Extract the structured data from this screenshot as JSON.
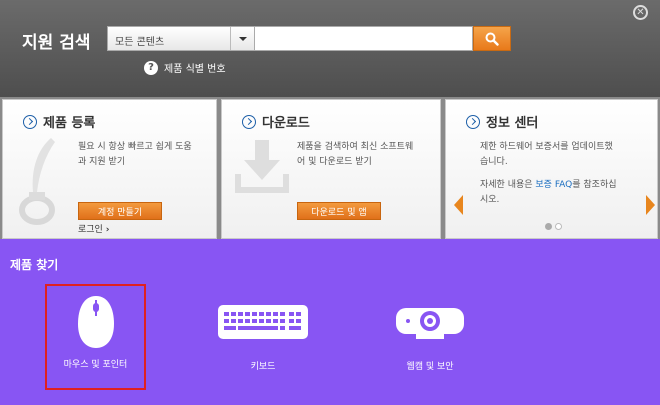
{
  "header": {
    "title": "지원 검색",
    "filter_value": "모든 콘텐츠",
    "search_value": "",
    "serial_link": "제품 식별 번호"
  },
  "cards": {
    "register": {
      "title": "제품 등록",
      "desc_line1": "필요 시 항상 빠르고 쉽게 도움",
      "desc_line2": "과 지원 받기",
      "button": "계정 만들기",
      "login": "로그인"
    },
    "download": {
      "title": "다운로드",
      "desc_line1": "제품을 검색하여 최신 소프트웨",
      "desc_line2": "어 및 다운로드 받기",
      "button": "다운로드 및 앱"
    },
    "info": {
      "title": "정보 센터",
      "desc_line1": "제한 하드웨어 보증서를 업데이트했",
      "desc_line2": "습니다.",
      "desc_line3_pre": "자세한 내용은 ",
      "desc_line3_link": "보증 FAQ",
      "desc_line3_post": "를 참조하십",
      "desc_line4": "시오."
    }
  },
  "products": {
    "title": "제품 찾기",
    "items": [
      {
        "label": "마우스 및 포인터"
      },
      {
        "label": "키보드"
      },
      {
        "label": "웹캠 및 보안"
      }
    ]
  },
  "colors": {
    "accent_orange": "#e8791a",
    "products_bg": "#8855f3",
    "selection_border": "#e02020",
    "link_blue": "#1d6fc0"
  }
}
